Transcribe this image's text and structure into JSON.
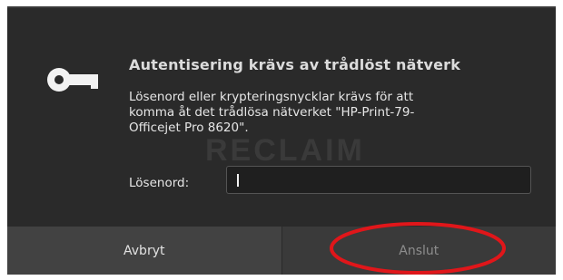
{
  "dialog": {
    "icon": "key-icon",
    "title": "Autentisering krävs av trådlöst nätverk",
    "message_lines": [
      "Lösenord eller krypteringsnycklar krävs för att",
      "komma åt det trådlösa nätverket \"HP-Print-79-",
      "Officejet Pro 8620\"."
    ],
    "watermark": "RECLAIM",
    "password_label": "Lösenord:",
    "password_value": "",
    "buttons": {
      "cancel": "Avbryt",
      "connect": "Anslut"
    },
    "colors": {
      "background": "#2a2a2a",
      "highlight_ring": "#e0161a"
    }
  }
}
